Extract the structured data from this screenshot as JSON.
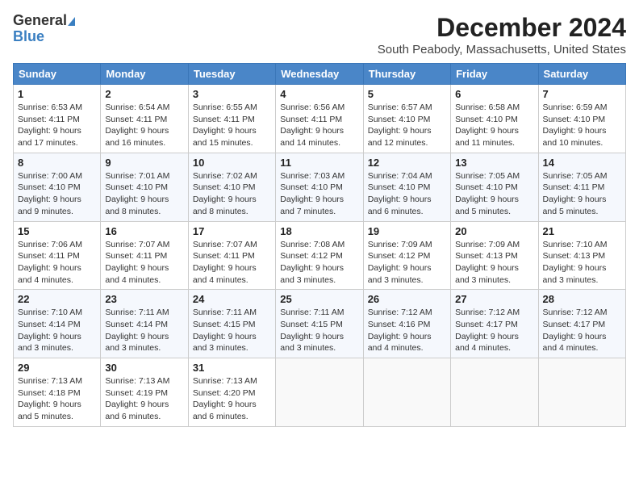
{
  "logo": {
    "line1": "General",
    "line2": "Blue"
  },
  "title": "December 2024",
  "location": "South Peabody, Massachusetts, United States",
  "days_of_week": [
    "Sunday",
    "Monday",
    "Tuesday",
    "Wednesday",
    "Thursday",
    "Friday",
    "Saturday"
  ],
  "weeks": [
    [
      {
        "day": "1",
        "info": "Sunrise: 6:53 AM\nSunset: 4:11 PM\nDaylight: 9 hours and 17 minutes."
      },
      {
        "day": "2",
        "info": "Sunrise: 6:54 AM\nSunset: 4:11 PM\nDaylight: 9 hours and 16 minutes."
      },
      {
        "day": "3",
        "info": "Sunrise: 6:55 AM\nSunset: 4:11 PM\nDaylight: 9 hours and 15 minutes."
      },
      {
        "day": "4",
        "info": "Sunrise: 6:56 AM\nSunset: 4:11 PM\nDaylight: 9 hours and 14 minutes."
      },
      {
        "day": "5",
        "info": "Sunrise: 6:57 AM\nSunset: 4:10 PM\nDaylight: 9 hours and 12 minutes."
      },
      {
        "day": "6",
        "info": "Sunrise: 6:58 AM\nSunset: 4:10 PM\nDaylight: 9 hours and 11 minutes."
      },
      {
        "day": "7",
        "info": "Sunrise: 6:59 AM\nSunset: 4:10 PM\nDaylight: 9 hours and 10 minutes."
      }
    ],
    [
      {
        "day": "8",
        "info": "Sunrise: 7:00 AM\nSunset: 4:10 PM\nDaylight: 9 hours and 9 minutes."
      },
      {
        "day": "9",
        "info": "Sunrise: 7:01 AM\nSunset: 4:10 PM\nDaylight: 9 hours and 8 minutes."
      },
      {
        "day": "10",
        "info": "Sunrise: 7:02 AM\nSunset: 4:10 PM\nDaylight: 9 hours and 8 minutes."
      },
      {
        "day": "11",
        "info": "Sunrise: 7:03 AM\nSunset: 4:10 PM\nDaylight: 9 hours and 7 minutes."
      },
      {
        "day": "12",
        "info": "Sunrise: 7:04 AM\nSunset: 4:10 PM\nDaylight: 9 hours and 6 minutes."
      },
      {
        "day": "13",
        "info": "Sunrise: 7:05 AM\nSunset: 4:10 PM\nDaylight: 9 hours and 5 minutes."
      },
      {
        "day": "14",
        "info": "Sunrise: 7:05 AM\nSunset: 4:11 PM\nDaylight: 9 hours and 5 minutes."
      }
    ],
    [
      {
        "day": "15",
        "info": "Sunrise: 7:06 AM\nSunset: 4:11 PM\nDaylight: 9 hours and 4 minutes."
      },
      {
        "day": "16",
        "info": "Sunrise: 7:07 AM\nSunset: 4:11 PM\nDaylight: 9 hours and 4 minutes."
      },
      {
        "day": "17",
        "info": "Sunrise: 7:07 AM\nSunset: 4:11 PM\nDaylight: 9 hours and 4 minutes."
      },
      {
        "day": "18",
        "info": "Sunrise: 7:08 AM\nSunset: 4:12 PM\nDaylight: 9 hours and 3 minutes."
      },
      {
        "day": "19",
        "info": "Sunrise: 7:09 AM\nSunset: 4:12 PM\nDaylight: 9 hours and 3 minutes."
      },
      {
        "day": "20",
        "info": "Sunrise: 7:09 AM\nSunset: 4:13 PM\nDaylight: 9 hours and 3 minutes."
      },
      {
        "day": "21",
        "info": "Sunrise: 7:10 AM\nSunset: 4:13 PM\nDaylight: 9 hours and 3 minutes."
      }
    ],
    [
      {
        "day": "22",
        "info": "Sunrise: 7:10 AM\nSunset: 4:14 PM\nDaylight: 9 hours and 3 minutes."
      },
      {
        "day": "23",
        "info": "Sunrise: 7:11 AM\nSunset: 4:14 PM\nDaylight: 9 hours and 3 minutes."
      },
      {
        "day": "24",
        "info": "Sunrise: 7:11 AM\nSunset: 4:15 PM\nDaylight: 9 hours and 3 minutes."
      },
      {
        "day": "25",
        "info": "Sunrise: 7:11 AM\nSunset: 4:15 PM\nDaylight: 9 hours and 3 minutes."
      },
      {
        "day": "26",
        "info": "Sunrise: 7:12 AM\nSunset: 4:16 PM\nDaylight: 9 hours and 4 minutes."
      },
      {
        "day": "27",
        "info": "Sunrise: 7:12 AM\nSunset: 4:17 PM\nDaylight: 9 hours and 4 minutes."
      },
      {
        "day": "28",
        "info": "Sunrise: 7:12 AM\nSunset: 4:17 PM\nDaylight: 9 hours and 4 minutes."
      }
    ],
    [
      {
        "day": "29",
        "info": "Sunrise: 7:13 AM\nSunset: 4:18 PM\nDaylight: 9 hours and 5 minutes."
      },
      {
        "day": "30",
        "info": "Sunrise: 7:13 AM\nSunset: 4:19 PM\nDaylight: 9 hours and 6 minutes."
      },
      {
        "day": "31",
        "info": "Sunrise: 7:13 AM\nSunset: 4:20 PM\nDaylight: 9 hours and 6 minutes."
      },
      null,
      null,
      null,
      null
    ]
  ]
}
